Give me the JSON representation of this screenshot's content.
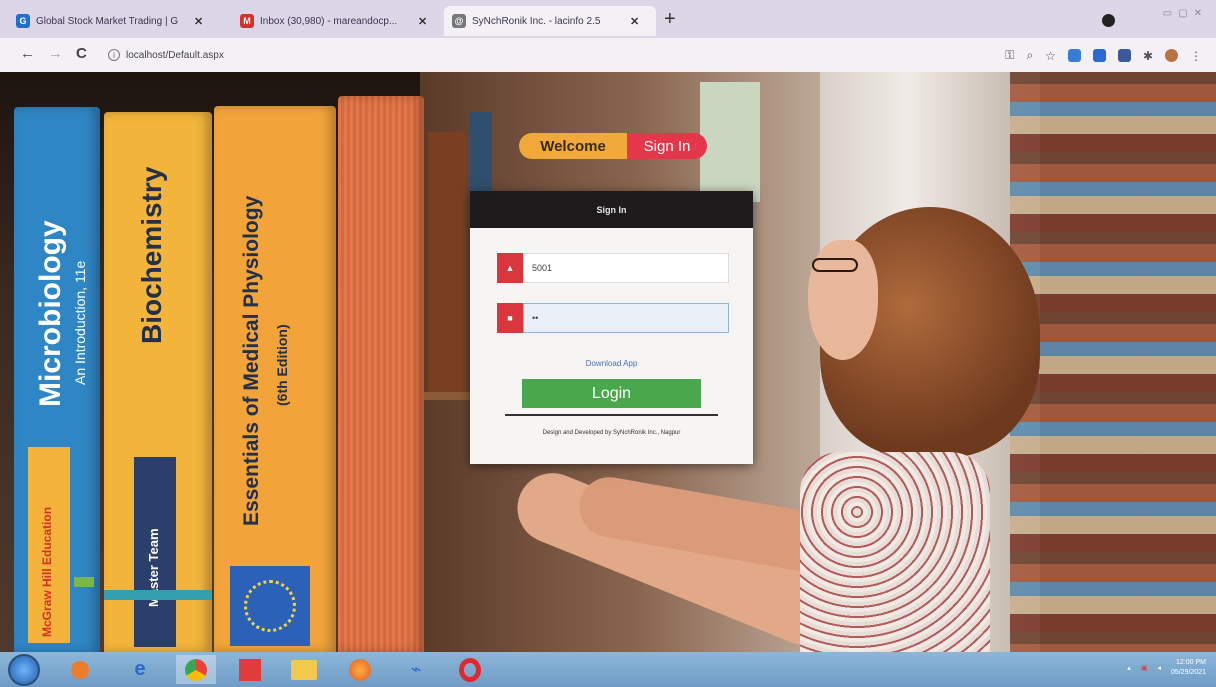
{
  "browser": {
    "tabs": [
      {
        "title": "Global Stock Market Trading | G",
        "favicon": "#1f6fd0",
        "favicon_glyph": "G",
        "active": false
      },
      {
        "title": "Inbox (30,980) - mareandocp...",
        "favicon": "#d93025",
        "favicon_glyph": "M",
        "active": false
      },
      {
        "title": "SyNchRonik Inc. - lacinfo 2.5",
        "favicon": "#555555",
        "favicon_glyph": "@",
        "active": true
      }
    ],
    "new_tab_label": "+",
    "back_label": "←",
    "forward_label": "→",
    "reload_label": "C",
    "url": "localhost/Default.aspx"
  },
  "hero": {
    "books": [
      {
        "title": "Microbiology",
        "subtitle": "An Introduction, 11e",
        "publisher": "McGraw Hill Education",
        "color": "#2f86c4"
      },
      {
        "title": "Biochemistry",
        "subtitle": "Master Team",
        "color": "#f3b43b"
      },
      {
        "title": "Essentials of Medical Physiology",
        "subtitle": "(6th Edition)",
        "color": "#f2a33a"
      }
    ]
  },
  "welcome": {
    "welcome_label": "Welcome",
    "signin_label": "Sign In"
  },
  "signin_card": {
    "header": "Sign In",
    "username_value": "5001",
    "password_value": "••",
    "download_link": "Download App",
    "login_label": "Login",
    "credits": "Design and Developed by SyNchRonik Inc., Nagpur"
  },
  "taskbar": {
    "clock_time": "12:00 PM",
    "clock_date": "05/29/2021"
  }
}
